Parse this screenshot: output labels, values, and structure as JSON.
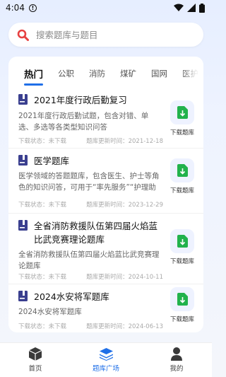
{
  "status_bar": {
    "time": "4:04",
    "warning_glyph": "!",
    "wifi_icon": "wifi-icon",
    "signal_icon": "signal-icon",
    "battery_icon": "battery-icon"
  },
  "search": {
    "placeholder": "搜索题库与题目",
    "icon": "search-icon",
    "accent": "#e64141"
  },
  "tabs": [
    {
      "label": "热门",
      "active": true
    },
    {
      "label": "公职",
      "active": false
    },
    {
      "label": "消防",
      "active": false
    },
    {
      "label": "煤矿",
      "active": false
    },
    {
      "label": "国网",
      "active": false
    },
    {
      "label": "医护",
      "active": false
    }
  ],
  "items": [
    {
      "title": "2021年度行政后勤复习",
      "description": "2021年度行政后勤试题，包含对错、单选、多选等各类型知识问答",
      "status_label": "下载状态：未下载",
      "updated_label": "题库更新时间：2021-12-18",
      "download_label": "下载题库"
    },
    {
      "title": "医学题库",
      "description": "医学领域的答题题库，包含医生、护士等角色的知识问答，可用于“率先服务”“护理助手”",
      "status_label": "下载状态：未下载",
      "updated_label": "题库更新时间：2023-12-29",
      "download_label": "下载题库"
    },
    {
      "title": "全省消防救援队伍第四届火焰蓝比武竞赛理论题库",
      "description": "全省消防救援队伍第四届火焰蓝比武竞赛理论题库",
      "status_label": "下载状态：未下载",
      "updated_label": "题库更新时间：2024-10-11",
      "download_label": "下载题库"
    },
    {
      "title": "2024水安将军题库",
      "description": "2024水安将军题库",
      "status_label": "下载状态：未下载",
      "updated_label": "题库更新时间：2024-06-13",
      "download_label": "下载题库"
    }
  ],
  "bottom_nav": [
    {
      "label": "首页",
      "icon": "cube-icon",
      "active": false
    },
    {
      "label": "题库广场",
      "icon": "layers-icon",
      "active": true
    },
    {
      "label": "我的",
      "icon": "user-icon",
      "active": false
    }
  ],
  "colors": {
    "primary": "#1f6fe8",
    "download_green": "#22b24c",
    "book_icon": "#3a3f8f"
  }
}
